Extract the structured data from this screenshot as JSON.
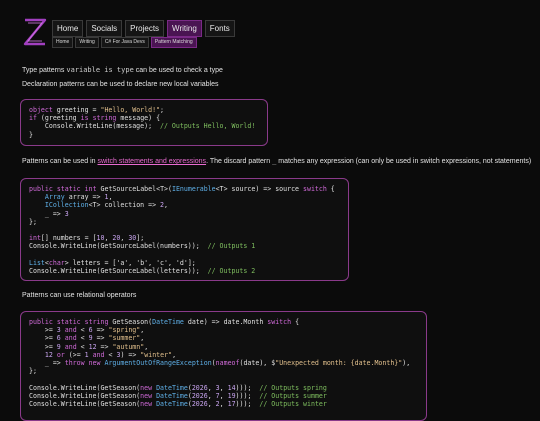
{
  "nav": {
    "items": [
      "Home",
      "Socials",
      "Projects",
      "Writing",
      "Fonts"
    ],
    "active": "Writing"
  },
  "breadcrumb": [
    "Home",
    "Writing",
    "C# For Java Devs",
    "Pattern Matching"
  ],
  "paragraphs": {
    "p1_pre": "Type patterns ",
    "p1_code": "variable is type",
    "p1_post": " can be used to check a type",
    "p2": "Declaration patterns can be used to declare new local variables",
    "p3_pre": "Patterns can be used in ",
    "p3_link": "switch statements and expressions",
    "p3_mid": ". The discard pattern ",
    "p3_code": "_",
    "p3_post": " matches any expression (can only be used in switch expressions, not statements)",
    "p4": "Patterns can use relational operators"
  },
  "code_blocks": [
    "object greeting = \"Hello, World!\";\nif (greeting is string message) {\n    Console.WriteLine(message);  // Outputs Hello, World!\n}",
    "public static int GetSourceLabel<T>(IEnumerable<T> source) => source switch {\n    Array array => 1,\n    ICollection<T> collection => 2,\n    _ => 3\n};\n\nint[] numbers = [10, 20, 30];\nConsole.WriteLine(GetSourceLabel(numbers));  // Outputs 1\n\nList<char> letters = ['a', 'b', 'c', 'd'];\nConsole.WriteLine(GetSourceLabel(letters));  // Outputs 2",
    "public static string GetSeason(DateTime date) => date.Month switch {\n    >= 3 and < 6 => \"spring\",\n    >= 6 and < 9 => \"summer\",\n    >= 9 and < 12 => \"autumn\",\n    12 or (>= 1 and < 3) => \"winter\",\n    _ => throw new ArgumentOutOfRangeException(nameof(date), $\"Unexpected month: {date.Month}\"),\n};\n\nConsole.WriteLine(GetSeason(new DateTime(2026, 3, 14)));  // Outputs spring\nConsole.WriteLine(GetSeason(new DateTime(2026, 7, 19)));  // Outputs summer\nConsole.WriteLine(GetSeason(new DateTime(2026, 2, 17)));  // Outputs winter"
  ],
  "colors": {
    "accent": "#4a1452",
    "border": "#8a3a8a",
    "keyword": "#d06ad8",
    "type": "#5fb0e8",
    "comment": "#7fbf5f",
    "link": "#e86ad0"
  },
  "icons": {
    "logo": "hourglass-logo-icon"
  }
}
